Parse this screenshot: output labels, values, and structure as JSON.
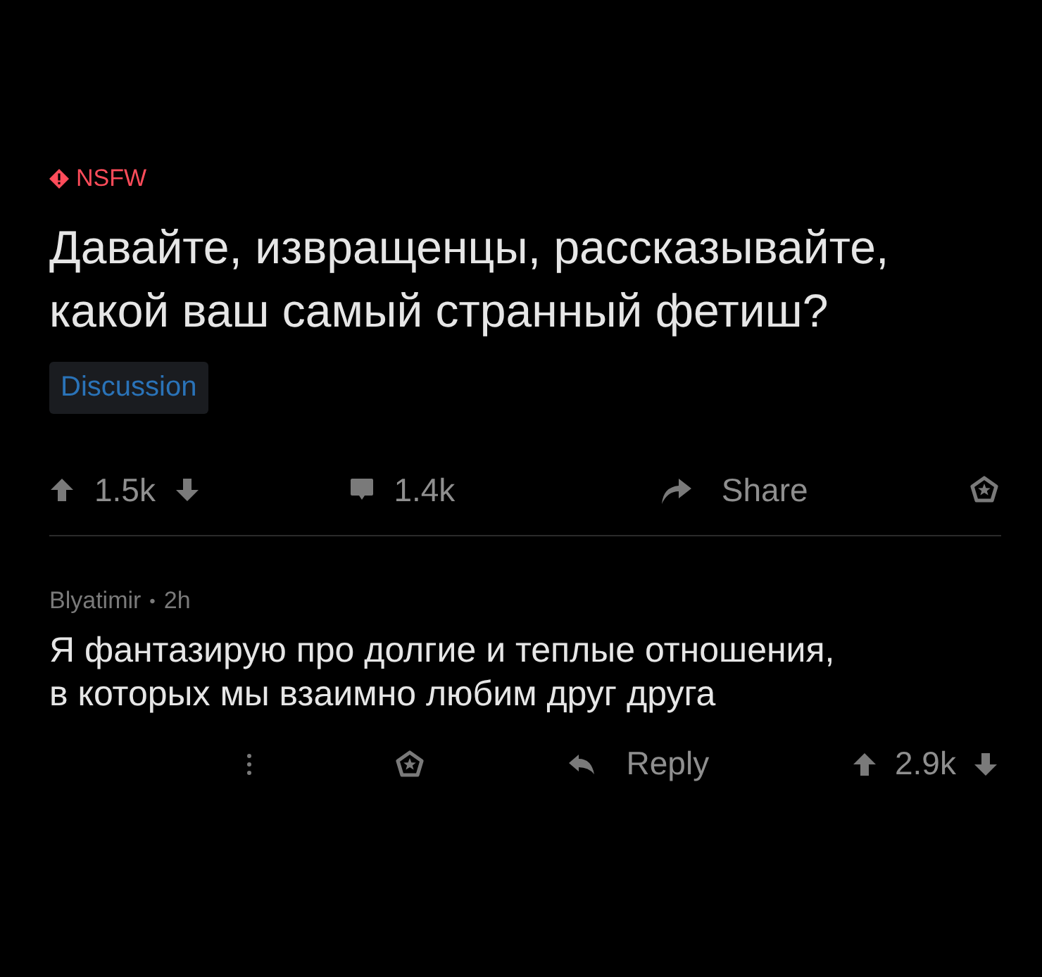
{
  "post": {
    "nsfw_label": "NSFW",
    "title": "Давайте, извращенцы, рассказывайте, какой ваш самый странный фетиш?",
    "flair": "Discussion",
    "actions": {
      "votes": "1.5k",
      "comments": "1.4k",
      "share": "Share"
    }
  },
  "comment": {
    "author": "Blyatimir",
    "separator": "•",
    "age": "2h",
    "body": "Я фантазирую про долгие и теплые отношения, в которых мы взаимно любим друг друга",
    "actions": {
      "reply": "Reply",
      "votes": "2.9k"
    }
  }
}
